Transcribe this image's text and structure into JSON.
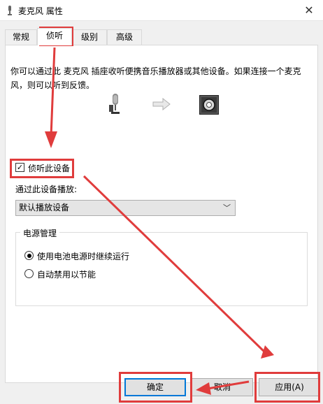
{
  "window": {
    "title": "麦克风 属性",
    "close_glyph": "✕"
  },
  "tabs": [
    {
      "label": "常规"
    },
    {
      "label": "侦听"
    },
    {
      "label": "级别"
    },
    {
      "label": "高级"
    }
  ],
  "listen": {
    "description": "你可以通过此 麦克风 插座收听便携音乐播放器或其他设备。如果连接一个麦克风，则可以听到反馈。",
    "checkbox_label": "侦听此设备",
    "checkbox_checked": true,
    "playback_label": "通过此设备播放:",
    "playback_selected": "默认播放设备",
    "power": {
      "title": "电源管理",
      "options": [
        {
          "label": "使用电池电源时继续运行",
          "checked": true
        },
        {
          "label": "自动禁用以节能",
          "checked": false
        }
      ]
    }
  },
  "buttons": {
    "ok": "确定",
    "cancel": "取消",
    "apply": "应用(A)"
  },
  "icons": {
    "title": "microphone-small-icon",
    "source": "microphone-icon",
    "arrow": "right-arrow-icon",
    "output": "speaker-icon",
    "close": "close-icon",
    "chevron": "chevron-down-icon"
  },
  "colors": {
    "annotation": "#e03c3c",
    "accent": "#0078d7"
  }
}
